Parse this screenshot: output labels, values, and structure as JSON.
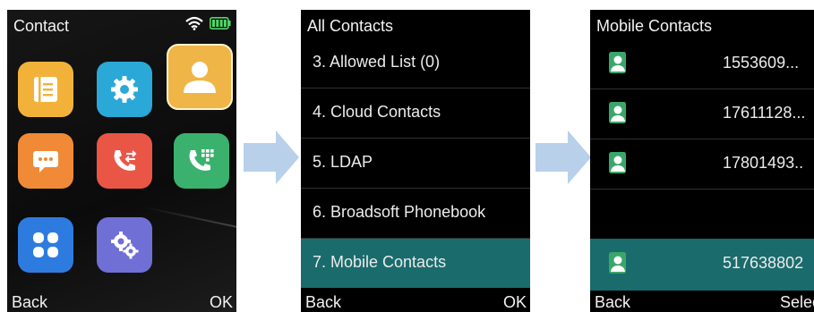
{
  "screen1": {
    "title": "Contact",
    "back": "Back",
    "ok": "OK",
    "tiles": [
      {
        "icon": "directory-list-icon",
        "color": "#f2b23a"
      },
      {
        "icon": "settings-gear-icon",
        "color": "#2aa8d8"
      },
      {
        "icon": "contact-person-icon",
        "color": "#f0b547",
        "selected": true
      },
      {
        "icon": "message-icon",
        "color": "#f08a36"
      },
      {
        "icon": "call-history-icon",
        "color": "#ea5646"
      },
      {
        "icon": "dialpad-icon",
        "color": "#3bb16e"
      },
      {
        "icon": "apps-grid-icon",
        "color": "#2e7be0"
      },
      {
        "icon": "advanced-settings-icon",
        "color": "#6f6fd6"
      }
    ]
  },
  "screen2": {
    "title": "All Contacts",
    "items": [
      "3. Allowed List (0)",
      "4. Cloud Contacts",
      "5. LDAP",
      "6. Broadsoft Phonebook",
      "7. Mobile Contacts"
    ],
    "selected_index": 4,
    "back": "Back",
    "ok": "OK"
  },
  "screen3": {
    "title": "Mobile Contacts",
    "rows": [
      "1553609...",
      "17611128...",
      "17801493..",
      "517638802"
    ],
    "selected_index": 3,
    "back": "Back",
    "select": "Select"
  },
  "colors": {
    "highlight": "#1a6b6c",
    "arrow": "#b8d0ea",
    "avatar": "#3aa66a"
  }
}
